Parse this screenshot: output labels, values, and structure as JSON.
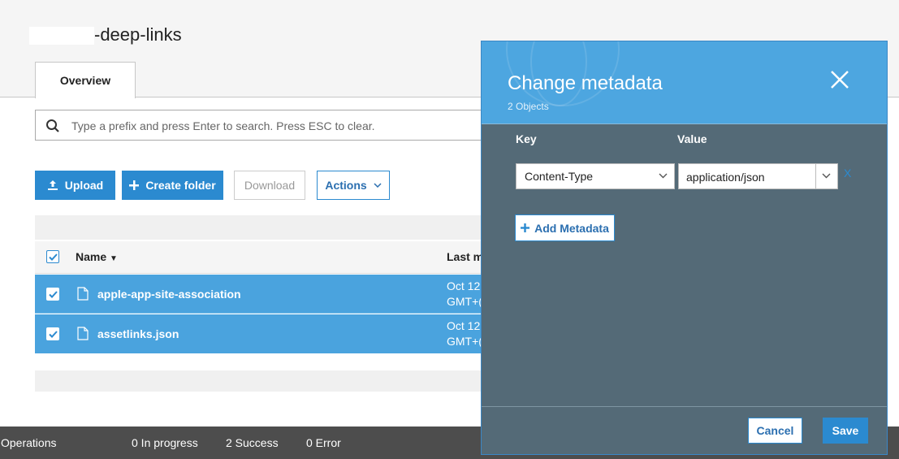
{
  "header": {
    "bucket_title": "-deep-links",
    "tab_overview": "Overview"
  },
  "search": {
    "placeholder": "Type a prefix and press Enter to search. Press ESC to clear."
  },
  "toolbar": {
    "upload_label": "Upload",
    "create_folder_label": "Create folder",
    "download_label": "Download",
    "actions_label": "Actions"
  },
  "table": {
    "col_name": "Name",
    "col_last_modified": "Last m",
    "rows": [
      {
        "name": "apple-app-site-association",
        "date_line1": "Oct 12",
        "date_line2": "GMT+("
      },
      {
        "name": "assetlinks.json",
        "date_line1": "Oct 12",
        "date_line2": "GMT+("
      }
    ]
  },
  "footer": {
    "operations": "Operations",
    "in_progress": "0 In progress",
    "success": "2 Success",
    "error": "0 Error"
  },
  "modal": {
    "title": "Change metadata",
    "subtitle": "2 Objects",
    "key_label": "Key",
    "value_label": "Value",
    "key_value": "Content-Type",
    "value_value": "application/json",
    "remove_label": "X",
    "add_metadata_label": "Add Metadata",
    "cancel_label": "Cancel",
    "save_label": "Save"
  },
  "colors": {
    "accent": "#2b8ad0",
    "selected_row": "#4aa3de",
    "modal_header": "#4da6e0",
    "modal_body": "#546a77",
    "footer": "#4d4d4d"
  }
}
